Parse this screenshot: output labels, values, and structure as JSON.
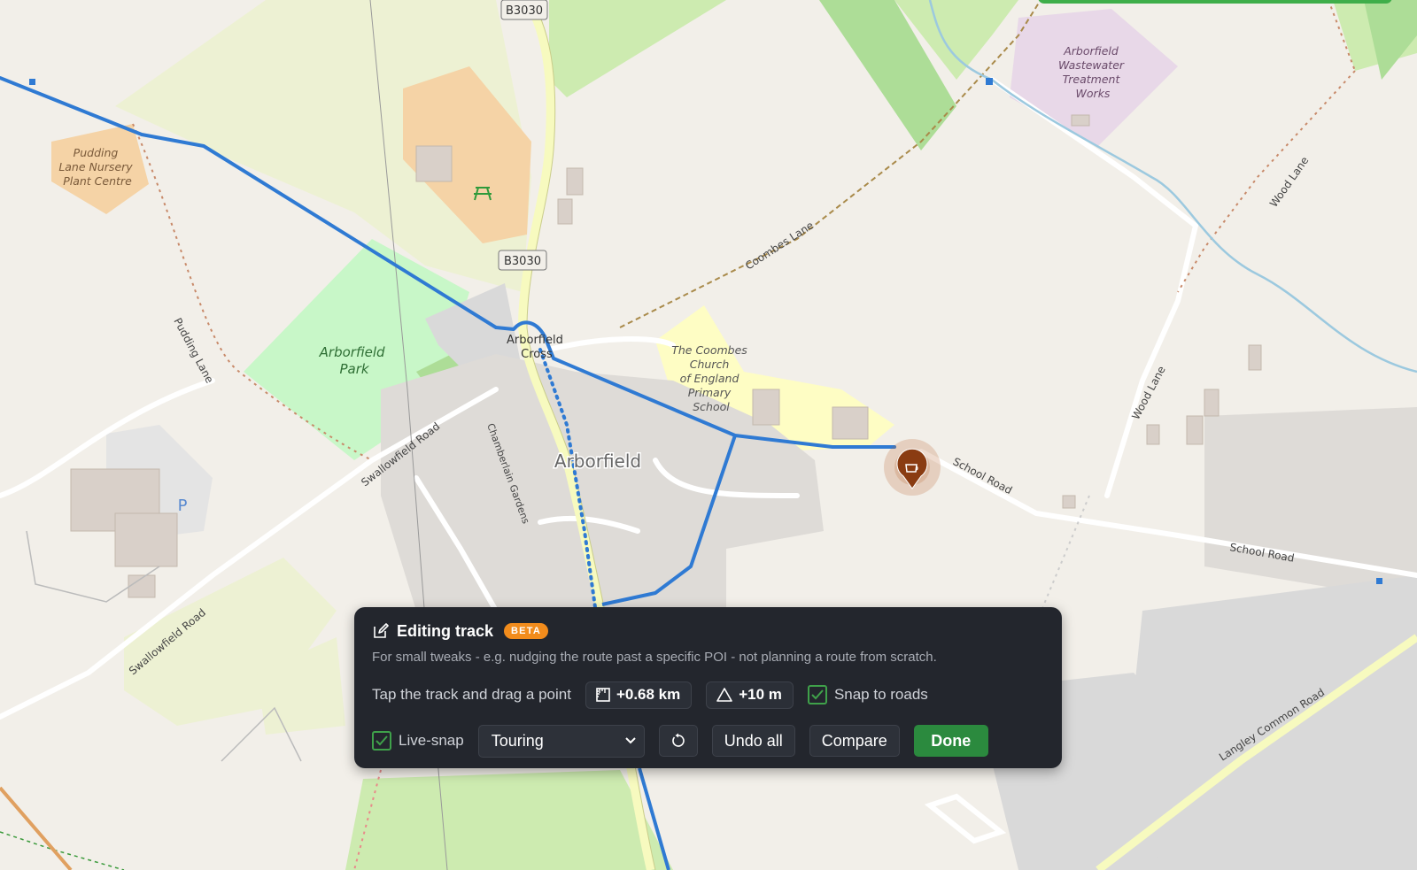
{
  "map": {
    "road_labels": {
      "b3030_top": "B3030",
      "b3030_mid": "B3030",
      "coombes_lane": "Coombes Lane",
      "wood_lane_1": "Wood Lane",
      "wood_lane_2": "Wood Lane",
      "pudding_lane": "Pudding Lane",
      "swallowfield_road_1": "Swallowfield Road",
      "swallowfield_road_2": "Swallowfield Road",
      "school_road_1": "School Road",
      "school_road_2": "School Road",
      "chamberlain_gardens": "Chamberlain Gardens",
      "langley_common_road": "Langley Common Road"
    },
    "place_labels": {
      "nursery": [
        "Pudding",
        "Lane Nursery",
        "Plant Centre"
      ],
      "park": [
        "Arborfield",
        "Park"
      ],
      "cross": [
        "Arborfield",
        "Cross"
      ],
      "village": "Arborfield",
      "school": [
        "The Coombes",
        "Church",
        "of England",
        "Primary",
        "School"
      ],
      "works": [
        "Arborfield",
        "Wastewater",
        "Treatment",
        "Works"
      ]
    },
    "parking_symbol": "P",
    "poi_marker_icon": "cafe-icon"
  },
  "panel": {
    "title": "Editing track",
    "badge": "BETA",
    "description": "For small tweaks - e.g. nudging the route past a specific POI - not planning a route from scratch.",
    "hint": "Tap the track and drag a point",
    "distance_delta": "+0.68 km",
    "elevation_delta": "+10 m",
    "snap_to_roads_label": "Snap to roads",
    "snap_to_roads_checked": true,
    "live_snap_label": "Live-snap",
    "live_snap_checked": true,
    "profile_selected": "Touring",
    "undo_all_label": "Undo all",
    "compare_label": "Compare",
    "done_label": "Done"
  },
  "colors": {
    "route": "#2f7ad3",
    "done_button": "#2b8a3e",
    "beta_badge": "#f28c1c",
    "poi_marker": "#8a3c12",
    "checkbox": "#3fa14a"
  }
}
